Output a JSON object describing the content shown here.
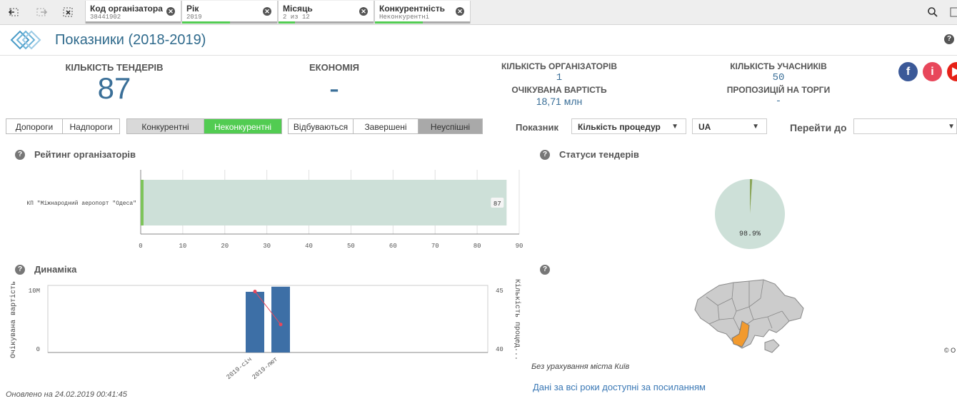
{
  "toolbar": {
    "chips": [
      {
        "title": "Код організатора",
        "value": "38441902",
        "fill": 0
      },
      {
        "title": "Рік",
        "value": "2019",
        "fill": 0.5
      },
      {
        "title": "Місяць",
        "value": "2 из 12",
        "fill": 0.17
      },
      {
        "title": "Конкурентність",
        "value": "Неконкурентні",
        "fill": 0.5
      }
    ]
  },
  "header": {
    "title": "Показники (2018-2019)"
  },
  "kpis": {
    "tenders_label": "КІЛЬКІСТЬ ТЕНДЕРІВ",
    "tenders_value": "87",
    "economy_label": "ЕКОНОМІЯ",
    "economy_value": "-",
    "organizers_label": "КІЛЬКІСТЬ ОРГАНІЗАТОРІВ",
    "organizers_value": "1",
    "expected_label": "ОЧІКУВАНА ВАРТІСТЬ",
    "expected_value": "18,71 млн",
    "participants_label": "КІЛЬКІСТЬ УЧАСНИКІВ",
    "participants_value": "50",
    "proposals_label": "ПРОПОЗИЦІЙ НА ТОРГИ",
    "proposals_value": "-"
  },
  "social": {
    "fb": "f",
    "info": "i"
  },
  "filters": {
    "btn1": "Допороги",
    "btn2": "Надпороги",
    "btn3": "Конкурентні",
    "btn4": "Неконкурентні",
    "btn5": "Відбуваються",
    "btn6": "Завершені",
    "btn7": "Неуспішні"
  },
  "controls": {
    "indicator_label": "Показник",
    "indicator_value": "Кількість процедур",
    "currency_value": "UA",
    "goto_label": "Перейти до",
    "goto_value": ""
  },
  "rating": {
    "title": "Рейтинг організаторів",
    "chart_data": {
      "type": "bar",
      "categories": [
        "КП \"Міжнародний аеропорт \"Одеса\""
      ],
      "values": [
        87
      ],
      "xlim": [
        0,
        90
      ],
      "ticks": [
        0,
        10,
        20,
        30,
        40,
        50,
        60,
        70,
        80,
        90
      ]
    }
  },
  "statuses": {
    "title": "Статуси тендерів",
    "chart_data": {
      "type": "pie",
      "slices": [
        {
          "value": 98.9,
          "label": "98.9%",
          "color": "#cde0d8"
        },
        {
          "value": 1.1,
          "label": "",
          "color": "#8aa65a"
        }
      ]
    }
  },
  "dynamics": {
    "title": "Динаміка",
    "chart_data": {
      "type": "bar",
      "categories": [
        "2019-січ",
        "2019-лют"
      ],
      "series": [
        {
          "name": "Очікувана вартість",
          "values": [
            9.5,
            10.3
          ],
          "axis": "left"
        },
        {
          "name": "Кількість процед...",
          "values": [
            45,
            42.3
          ],
          "axis": "right"
        }
      ],
      "ylabel_left": "Очікувана вартість",
      "ylabel_right": "Кількість процед...",
      "yticks_left": [
        "10M",
        "0"
      ],
      "yticks_right": [
        "45",
        "40"
      ],
      "ylim_left": [
        0,
        10.5
      ],
      "ylim_right": [
        40,
        45.5
      ]
    }
  },
  "map": {
    "note": "Без урахування міста Київ",
    "copyright": "© O"
  },
  "footer": {
    "updated": "Оновлено на 24.02.2019 00:41:45",
    "link": "Дані за всі роки доступні за посиланням"
  },
  "colors": {
    "accent": "#3a6f98",
    "green": "#52cc52",
    "bar": "#3d6fa6",
    "highlight": "#f29a2e"
  }
}
